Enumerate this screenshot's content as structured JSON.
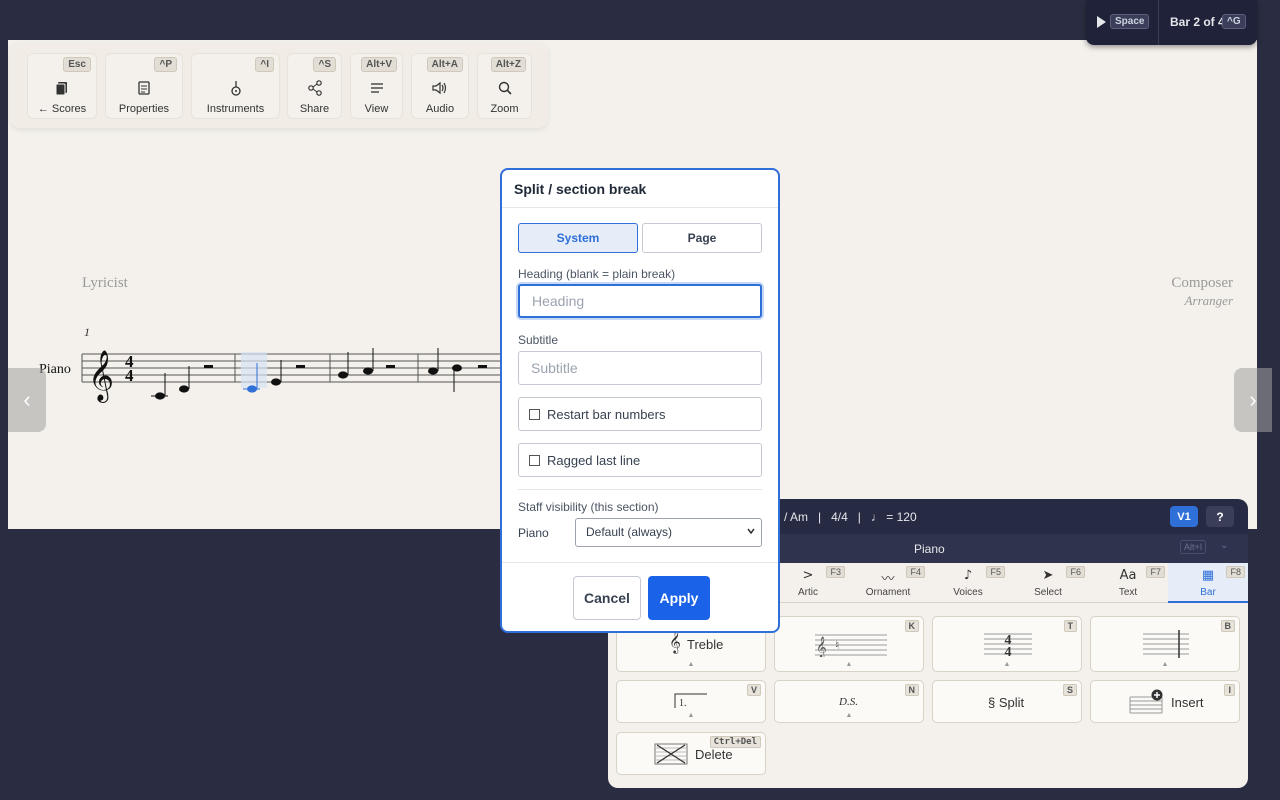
{
  "toolbar": {
    "buttons": [
      {
        "label": "← Scores",
        "key": "Esc"
      },
      {
        "label": "Properties",
        "key": "^P"
      },
      {
        "label": "Instruments",
        "key": "^I"
      },
      {
        "label": "Share",
        "key": "^S"
      },
      {
        "label": "View",
        "key": "Alt+V"
      },
      {
        "label": "Audio",
        "key": "Alt+A"
      },
      {
        "label": "Zoom",
        "key": "Alt+Z"
      }
    ]
  },
  "playbar": {
    "play_key": "Space",
    "bar_position": "Bar 2 of 4",
    "goto_key": "^G"
  },
  "score": {
    "lyricist": "Lyricist",
    "composer": "Composer",
    "arranger": "Arranger",
    "bar_number": "1",
    "instrument": "Piano",
    "time_signature_top": "4",
    "time_signature_bottom": "4"
  },
  "nav": {
    "prev": "‹",
    "next": "›"
  },
  "palette": {
    "info": "/ Am   |   4/4   |   ♩ = 120",
    "voice_button": "V1",
    "help_button": "?",
    "instrument": "Piano",
    "instrument_key": "Alt+I",
    "instrument_chevron": "⌄",
    "tabs": [
      {
        "label": "Artic",
        "key": "F3",
        "icon": ">"
      },
      {
        "label": "Ornament",
        "key": "F4",
        "icon": "〰"
      },
      {
        "label": "Voices",
        "key": "F5",
        "icon": "♪"
      },
      {
        "label": "Select",
        "key": "F6",
        "icon": "➤"
      },
      {
        "label": "Text",
        "key": "F7",
        "icon": "Aa"
      },
      {
        "label": "Bar",
        "key": "F8",
        "icon": "▦"
      }
    ],
    "grid": {
      "treble_label": "Treble",
      "key_sig_key": "K",
      "time_sig_key": "T",
      "time_sig_top": "4",
      "time_sig_bottom": "4",
      "barline_key": "B",
      "volta_key": "V",
      "volta_text": "1.",
      "ds_key": "N",
      "ds_label": "D.S.",
      "split_key": "S",
      "split_label": "§ Split",
      "insert_key": "I",
      "insert_label": "Insert",
      "delete_key": "Ctrl+Del",
      "delete_label": "Delete",
      "caret": "▲"
    }
  },
  "dialog": {
    "title": "Split / section break",
    "segments": [
      "System",
      "Page"
    ],
    "heading_label": "Heading (blank = plain break)",
    "heading_placeholder": "Heading",
    "subtitle_label": "Subtitle",
    "subtitle_placeholder": "Subtitle",
    "restart_bar_numbers": "Restart bar numbers",
    "ragged_last_line": "Ragged last line",
    "staff_visibility_title": "Staff visibility (this section)",
    "staff_instrument": "Piano",
    "staff_visibility_value": "Default (always)",
    "cancel": "Cancel",
    "apply": "Apply"
  }
}
